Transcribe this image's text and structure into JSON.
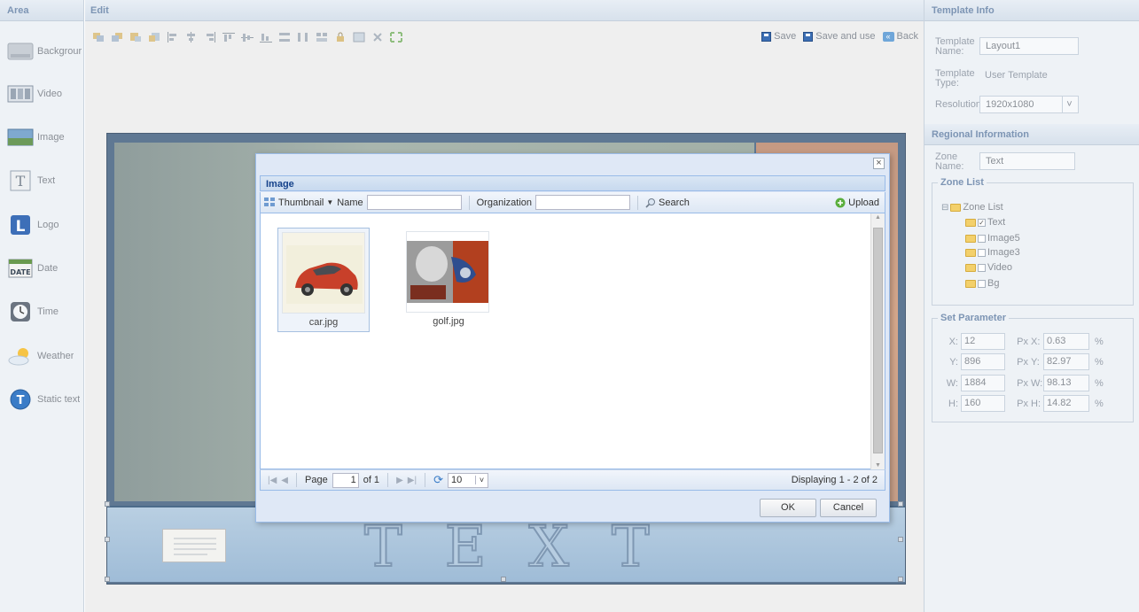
{
  "area": {
    "title": "Area",
    "items": [
      {
        "label": "Backgrour",
        "icon": "background-icon"
      },
      {
        "label": "Video",
        "icon": "video-icon"
      },
      {
        "label": "Image",
        "icon": "image-icon"
      },
      {
        "label": "Text",
        "icon": "text-icon"
      },
      {
        "label": "Logo",
        "icon": "logo-icon"
      },
      {
        "label": "Date",
        "icon": "date-icon"
      },
      {
        "label": "Time",
        "icon": "clock-icon"
      },
      {
        "label": "Weather",
        "icon": "weather-icon"
      },
      {
        "label": "Static text",
        "icon": "static-text-icon"
      }
    ]
  },
  "edit": {
    "title": "Edit",
    "save_label": "Save",
    "save_use_label": "Save and use",
    "back_label": "Back"
  },
  "canvas": {
    "text_zone_text": "TEXT",
    "date_icon_text": "DATE"
  },
  "template_info": {
    "title": "Template Info",
    "name_label": "Template Name:",
    "name_value": "Layout1",
    "type_label": "Template Type:",
    "type_value": "User Template",
    "resolution_label": "Resolution:",
    "resolution_value": "1920x1080"
  },
  "regional": {
    "title": "Regional Information",
    "zone_name_label": "Zone Name:",
    "zone_name_value": "Text",
    "zone_list_legend": "Zone List",
    "zone_root": "Zone List",
    "zones": [
      {
        "label": "Text",
        "checked": true
      },
      {
        "label": "Image5",
        "checked": false
      },
      {
        "label": "Image3",
        "checked": false
      },
      {
        "label": "Video",
        "checked": false
      },
      {
        "label": "Bg",
        "checked": false
      }
    ]
  },
  "params": {
    "legend": "Set Parameter",
    "px_unit": "Px",
    "pct_unit": "%",
    "rows": [
      {
        "label": "X:",
        "px": "12",
        "pct_label": "X:",
        "pct": "0.63"
      },
      {
        "label": "Y:",
        "px": "896",
        "pct_label": "Y:",
        "pct": "82.97"
      },
      {
        "label": "W:",
        "px": "1884",
        "pct_label": "W:",
        "pct": "98.13"
      },
      {
        "label": "H:",
        "px": "160",
        "pct_label": "H:",
        "pct": "14.82"
      }
    ]
  },
  "dialog": {
    "title": "Image",
    "close_glyph": "×",
    "thumbnail_label": "Thumbnail",
    "name_label": "Name",
    "organization_label": "Organization",
    "search_label": "Search",
    "upload_label": "Upload",
    "files": [
      {
        "caption": "car.jpg",
        "selected": true
      },
      {
        "caption": "golf.jpg",
        "selected": false
      }
    ],
    "page_label": "Page",
    "page_value": "1",
    "of_label": "of 1",
    "page_size": "10",
    "displaying": "Displaying 1 - 2 of 2",
    "ok_label": "OK",
    "cancel_label": "Cancel"
  }
}
